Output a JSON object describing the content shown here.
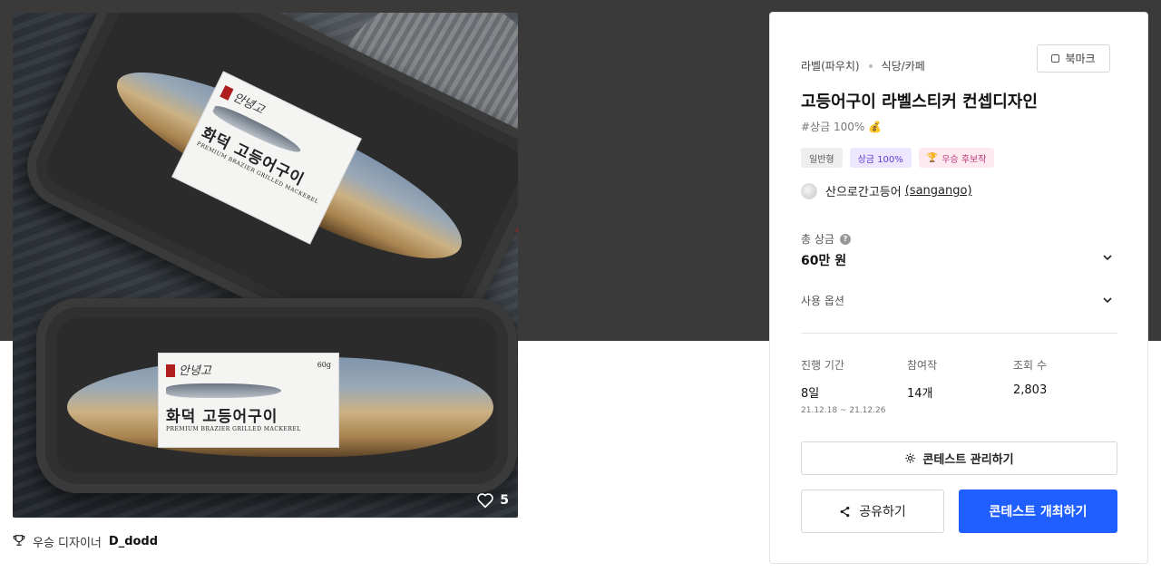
{
  "gallery": {
    "label_brand": "안녕고",
    "label_title": "화덕 고등어구이",
    "label_subtitle": "PREMIUM BRAZIER GRILLED MACKEREL",
    "label_weight": "60g",
    "likes": "5"
  },
  "designer": {
    "prefix": "우승 디자이너",
    "name": "D_dodd"
  },
  "panel": {
    "breadcrumb": [
      "라벨(파우치)",
      "식당/카페"
    ],
    "bookmark_label": "북마크",
    "title": "고등어구이 라벨스티커 컨셉디자인",
    "hashtag": "#상금 100% 💰",
    "badges": {
      "type": "일반형",
      "prize": "상금 100%",
      "winner": "우승 후보작"
    },
    "host": {
      "name": "산으로간고등어",
      "id": "(sangango)"
    },
    "prize_label": "총 상금",
    "prize_value": "60만 원",
    "options_label": "사용 옵션",
    "stats": [
      {
        "label": "진행 기간",
        "value": "8일",
        "sub": "21.12.18 ~ 21.12.26"
      },
      {
        "label": "참여작",
        "value": "14개"
      },
      {
        "label": "조회 수",
        "value": "2,803"
      }
    ],
    "manage_label": "콘테스트 관리하기",
    "share_label": "공유하기",
    "host_contest_label": "콘테스트 개최하기"
  },
  "colors": {
    "primary": "#1f5eff",
    "hero_bg": "#3a3a3a"
  }
}
